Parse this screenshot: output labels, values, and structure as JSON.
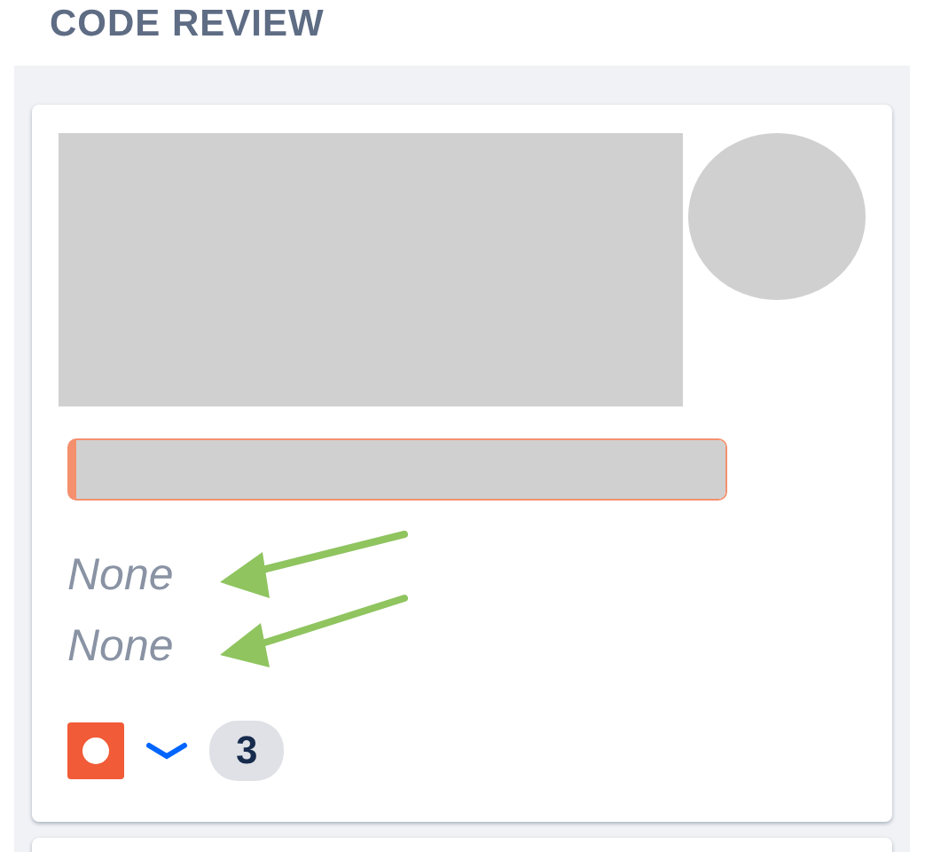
{
  "column": {
    "title": "CODE REVIEW"
  },
  "card": {
    "fields": [
      {
        "value": "None"
      },
      {
        "value": "None"
      }
    ],
    "footer": {
      "icons": [
        {
          "kind": "bug"
        },
        {
          "kind": "chevron"
        }
      ],
      "count": "3"
    }
  }
}
